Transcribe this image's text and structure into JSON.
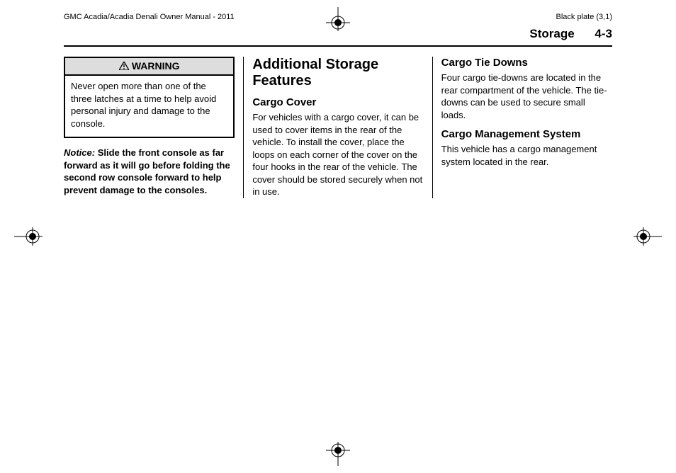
{
  "meta": {
    "manual_title": "GMC Acadia/Acadia Denali Owner Manual - 2011",
    "plate": "Black plate (3,1)"
  },
  "page_header": {
    "section": "Storage",
    "page_num": "4-3"
  },
  "col1": {
    "warning_label": "WARNING",
    "warning_body": "Never open more than one of the three latches at a time to help avoid personal injury and damage to the console.",
    "notice_label": "Notice:",
    "notice_text": "Slide the front console as far forward as it will go before folding the second row console forward to help prevent damage to the consoles."
  },
  "col2": {
    "h1": "Additional Storage Features",
    "sub1": "Cargo Cover",
    "p1": "For vehicles with a cargo cover, it can be used to cover items in the rear of the vehicle. To install the cover, place the loops on each corner of the cover on the four hooks in the rear of the vehicle. The cover should be stored securely when not in use."
  },
  "col3": {
    "sub1": "Cargo Tie Downs",
    "p1": "Four cargo tie-downs are located in the rear compartment of the vehicle. The tie-downs can be used to secure small loads.",
    "sub2": "Cargo Management System",
    "p2": "This vehicle has a cargo management system located in the rear."
  }
}
